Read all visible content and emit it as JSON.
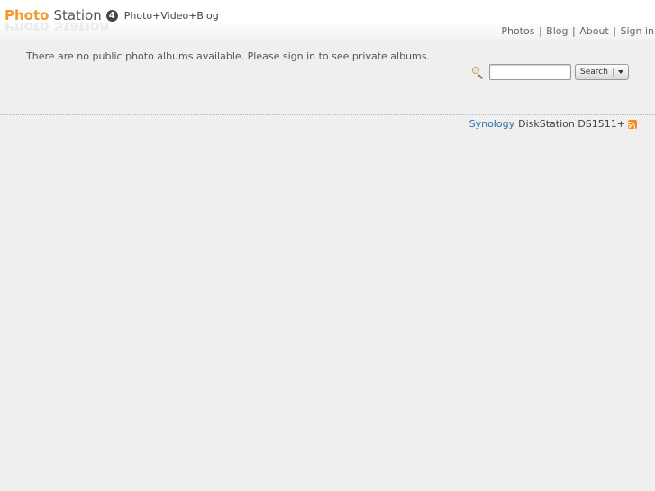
{
  "header": {
    "logo_photo": "Photo",
    "logo_station": "Station",
    "logo_version": "4",
    "tagline": "Photo+Video+Blog"
  },
  "nav": {
    "items": [
      {
        "label": "Photos"
      },
      {
        "label": "Blog"
      },
      {
        "label": "About"
      },
      {
        "label": "Sign in"
      }
    ],
    "separator": "|"
  },
  "main": {
    "notice": "There are no public photo albums available. Please sign in to see private albums."
  },
  "search": {
    "value": "",
    "button_label": "Search",
    "icon": "search-icon"
  },
  "footer": {
    "brand_link": "Synology",
    "device": "DiskStation DS1511+",
    "icon": "rss-icon"
  },
  "colors": {
    "background": "#efefef",
    "logo_accent": "#f49a2b",
    "link": "#2a6fb0",
    "rss": "#f28c1e"
  }
}
